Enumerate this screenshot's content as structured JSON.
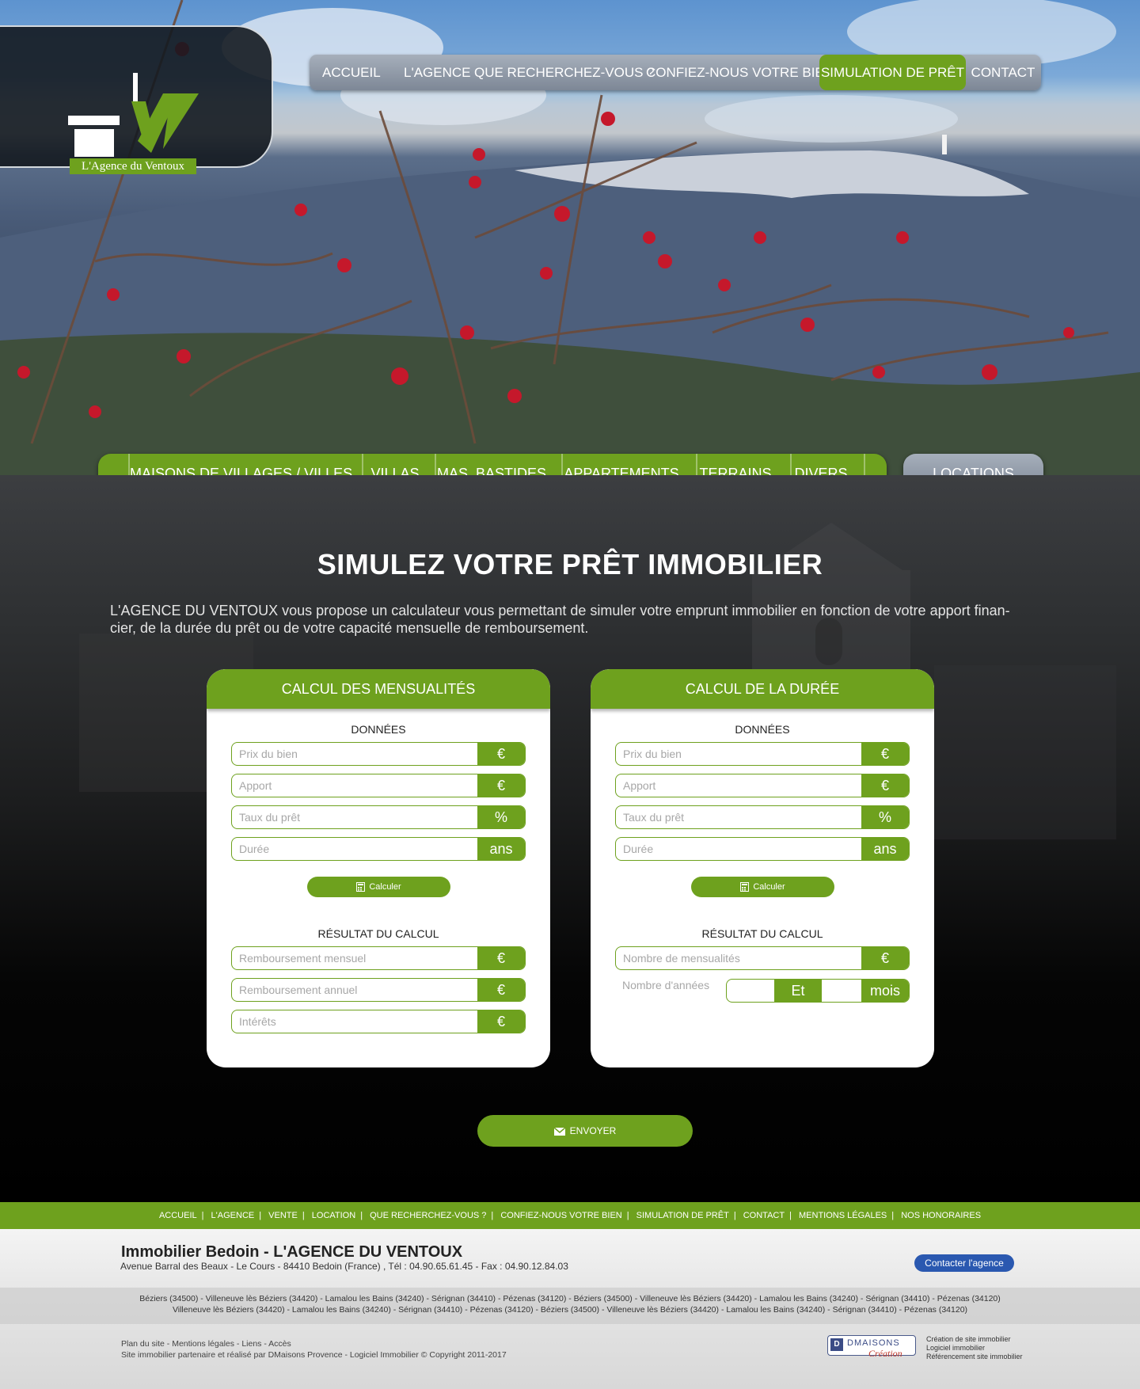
{
  "brand": {
    "logo_letters": "AV",
    "logo_tagline": "L'Agence du Ventoux",
    "green": "#6ea11e",
    "grey_nav": "#8a93a0",
    "blue": "#2a58b0"
  },
  "top_nav": {
    "items": [
      "ACCUEIL",
      "L'AGENCE",
      "QUE RECHERCHEZ-VOUS ?",
      "CONFIEZ-NOUS VOTRE BIEN",
      "SIMULATION DE PRÊT",
      "CONTACT"
    ],
    "active": "SIMULATION DE PRÊT"
  },
  "categories": {
    "items": [
      "MAISONS DE VILLAGES / VILLES",
      "VILLAS",
      "MAS, BASTIDES",
      "APPARTEMENTS",
      "TERRAINS",
      "DIVERS"
    ],
    "locations": "LOCATIONS"
  },
  "main": {
    "title": "SIMULEZ VOTRE PRÊT IMMOBILIER",
    "intro_line1": "L'AGENCE DU VENTOUX vous propose un calculateur vous permettant de simuler votre emprunt immobilier en fonction de votre apport finan-",
    "intro_line2": "cier, de la durée du prêt ou de votre capacité mensuelle de remboursement."
  },
  "card_mensualites": {
    "title": "CALCUL DES MENSUALITÉS",
    "data_label": "DONNÉES",
    "inputs": [
      {
        "placeholder": "Prix du bien",
        "unit": "€"
      },
      {
        "placeholder": "Apport",
        "unit": "€"
      },
      {
        "placeholder": "Taux du prêt",
        "unit": "%"
      },
      {
        "placeholder": "Durée",
        "unit": "ans"
      }
    ],
    "calc_button": "Calculer",
    "result_label": "RÉSULTAT DU CALCUL",
    "results": [
      {
        "placeholder": "Remboursement mensuel",
        "unit": "€"
      },
      {
        "placeholder": "Remboursement annuel",
        "unit": "€"
      },
      {
        "placeholder": "Intérêts",
        "unit": "€"
      }
    ]
  },
  "card_duree": {
    "title": "CALCUL DE LA DURÉE",
    "data_label": "DONNÉES",
    "inputs": [
      {
        "placeholder": "Prix du bien",
        "unit": "€"
      },
      {
        "placeholder": "Apport",
        "unit": "€"
      },
      {
        "placeholder": "Taux du prêt",
        "unit": "%"
      },
      {
        "placeholder": "Durée",
        "unit": "ans"
      }
    ],
    "calc_button": "Calculer",
    "result_label": "RÉSULTAT DU CALCUL",
    "results": [
      {
        "placeholder": "Nombre de mensualités",
        "unit": "€"
      }
    ],
    "years_label": "Nombre d'années",
    "years_mid": "Et",
    "years_unit": "mois"
  },
  "send_button": "ENVOYER",
  "footer_nav": [
    "ACCUEIL",
    "L'AGENCE",
    "VENTE",
    "LOCATION",
    "QUE RECHERCHEZ-VOUS ?",
    "CONFIEZ-NOUS VOTRE BIEN",
    "SIMULATION DE PRÊT",
    "CONTACT",
    "MENTIONS LÉGALES",
    "NOS HONORAIRES"
  ],
  "footer": {
    "title": "Immobilier Bedoin - L'AGENCE DU VENTOUX",
    "address": "Avenue Barral des Beaux - Le Cours - 84410 Bedoin (France) , Tél : 04.90.65.61.45 - Fax : 04.90.12.84.03",
    "contact_button": "Contacter l'agence",
    "towns_line1": "Béziers (34500) - Villeneuve lès Béziers (34420) - Lamalou les Bains (34240) - Sérignan (34410) - Pézenas (34120) - Béziers (34500) - Villeneuve lès Béziers (34420) - Lamalou les Bains (34240) - Sérignan (34410) - Pézenas (34120)",
    "towns_line2": "Villeneuve lès Béziers (34420) - Lamalou les Bains (34240) - Sérignan (34410) - Pézenas (34120) - Béziers (34500) - Villeneuve lès Béziers (34420) - Lamalou les Bains (34240) - Sérignan (34410) - Pézenas (34120)",
    "links": "Plan du site - Mentions légales - Liens - Accès",
    "credit": "Site immobilier partenaire et réalisé par DMaisons Provence - Logiciel Immobilier © Copyright 2011-2017",
    "dm_name": "DMAISONS",
    "dm_sub": "Création",
    "dm_lines": [
      "Création de site immobilier",
      "Logiciel immobilier",
      "Référencement site immobilier"
    ]
  }
}
